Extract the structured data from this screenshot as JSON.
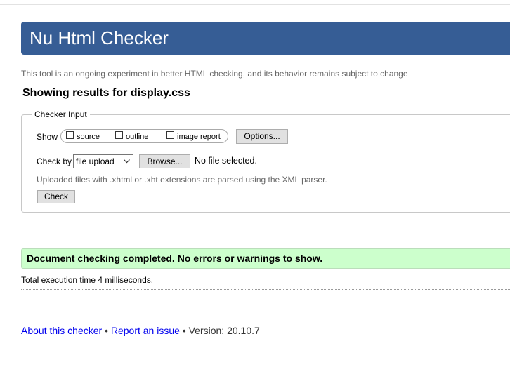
{
  "header": {
    "title": "Nu Html Checker"
  },
  "tagline": "This tool is an ongoing experiment in better HTML checking, and its behavior remains subject to change",
  "results_heading": "Showing results for display.css",
  "checker_input": {
    "legend": "Checker Input",
    "show_label": "Show",
    "show_options": [
      {
        "label": "source",
        "checked": false
      },
      {
        "label": "outline",
        "checked": false
      },
      {
        "label": "image report",
        "checked": false
      }
    ],
    "options_button": "Options...",
    "check_by_label": "Check by",
    "check_by_value": "file upload",
    "browse_button": "Browse...",
    "file_status": "No file selected.",
    "note": "Uploaded files with .xhtml or .xht extensions are parsed using the XML parser.",
    "check_button": "Check"
  },
  "result": {
    "message": "Document checking completed. No errors or warnings to show.",
    "execution_time": "Total execution time 4 milliseconds."
  },
  "footer": {
    "about_link": "About this checker",
    "separator": "•",
    "report_link": "Report an issue",
    "version": "Version: 20.10.7"
  },
  "colors": {
    "header_bg": "#365d95",
    "success_bg": "#ccffcc",
    "link": "#0000ee"
  }
}
